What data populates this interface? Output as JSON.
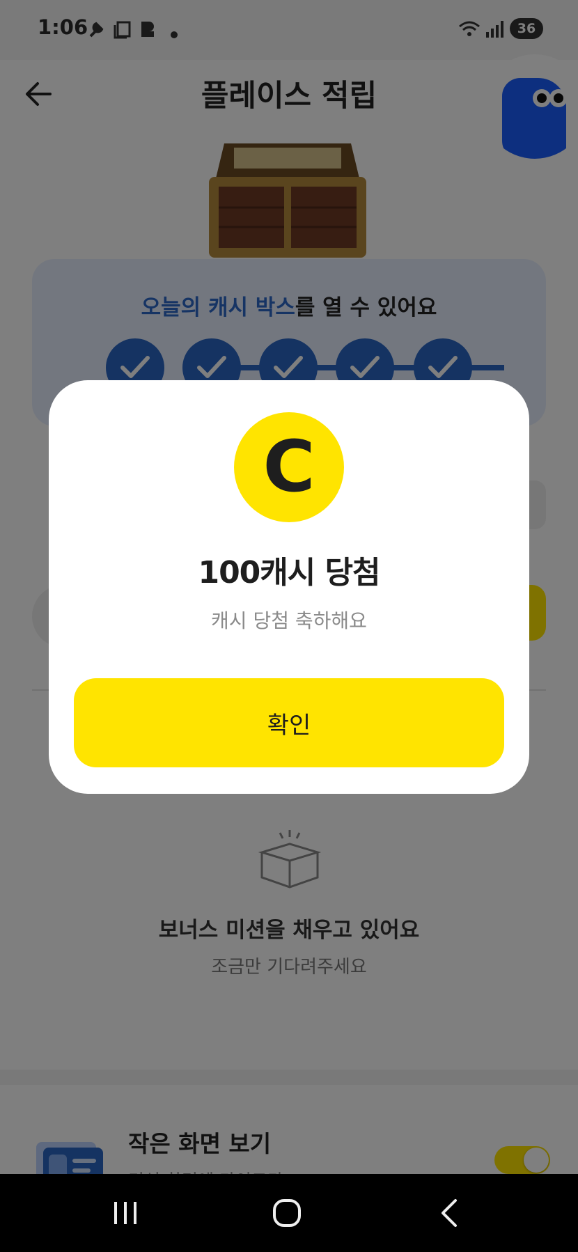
{
  "status_bar": {
    "time": "1:06",
    "icons": [
      "wrench-icon",
      "screen-icon",
      "app-icon",
      "dot-icon",
      "wifi-icon",
      "signal-icon"
    ],
    "battery": "36"
  },
  "header": {
    "back_icon": "arrow-left-icon",
    "title": "플레이스 적립"
  },
  "cash_box": {
    "title_highlight": "오늘의 캐시 박스",
    "title_rest": "를 열 수 있어요",
    "steps_completed": 5,
    "steps_total": 5
  },
  "bonus_empty": {
    "title": "보너스 미션을 채우고 있어요",
    "subtitle": "조금만 기다려주세요"
  },
  "small_screen": {
    "title": "작은 화면 보기",
    "subtitle": "미션 화면에 가이드가 ...",
    "toggle_on": true
  },
  "modal": {
    "coin_letter": "C",
    "title": "100캐시 당첨",
    "subtitle": "캐시 당첨 축하해요",
    "confirm_label": "확인"
  },
  "colors": {
    "accent_blue": "#2a66c4",
    "accent_yellow": "#ffe400",
    "overlay": "rgba(0,0,0,0.5)"
  }
}
